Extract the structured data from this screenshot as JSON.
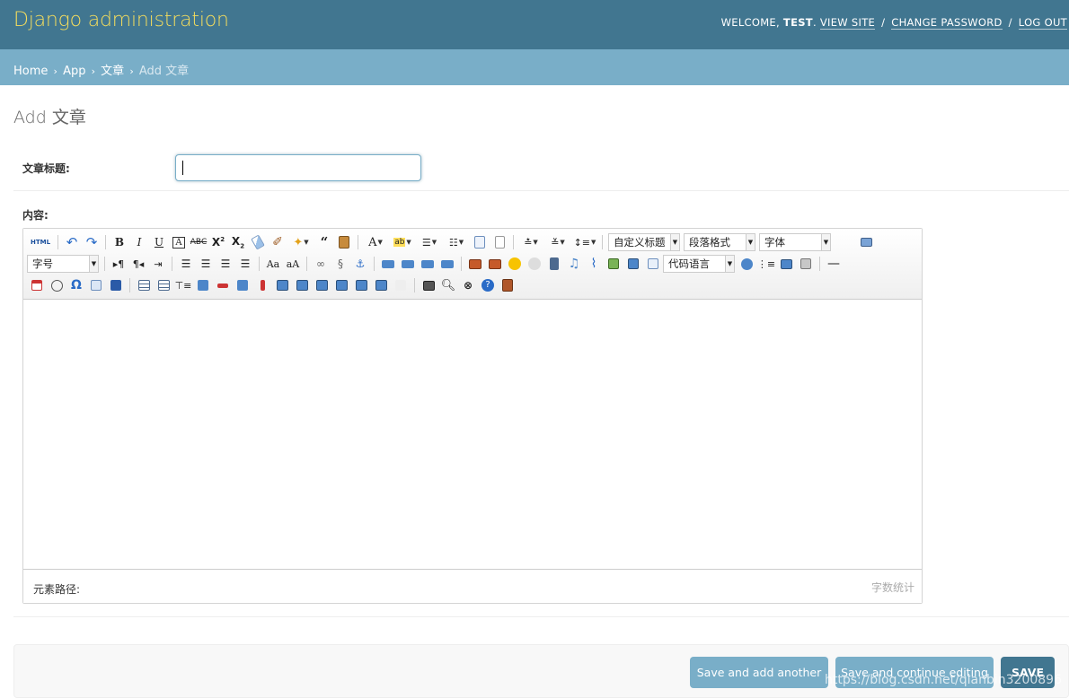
{
  "header": {
    "site_name": "Django administration",
    "welcome": "WELCOME,",
    "user": "TEST",
    "view_site": "VIEW SITE",
    "change_password": "CHANGE PASSWORD",
    "log_out": "LOG OUT",
    "sep": "/"
  },
  "breadcrumbs": {
    "home": "Home",
    "app": "App",
    "model": "文章",
    "current": "Add 文章",
    "arrow": "›"
  },
  "page_title": "Add 文章",
  "form": {
    "title_label": "文章标题:",
    "title_value": "",
    "content_label": "内容:"
  },
  "editor": {
    "toolbar": {
      "custom_title": "自定义标题",
      "paragraph": "段落格式",
      "font_family": "字体",
      "font_size": "字号",
      "code_lang": "代码语言",
      "html_label": "HTML"
    },
    "status_path": "元素路径:",
    "word_count": "字数统计"
  },
  "buttons": {
    "save_add_another": "Save and add another",
    "save_continue": "Save and continue editing",
    "save": "SAVE"
  },
  "watermark": "https://blog.csdn.net/qianbin3200896"
}
